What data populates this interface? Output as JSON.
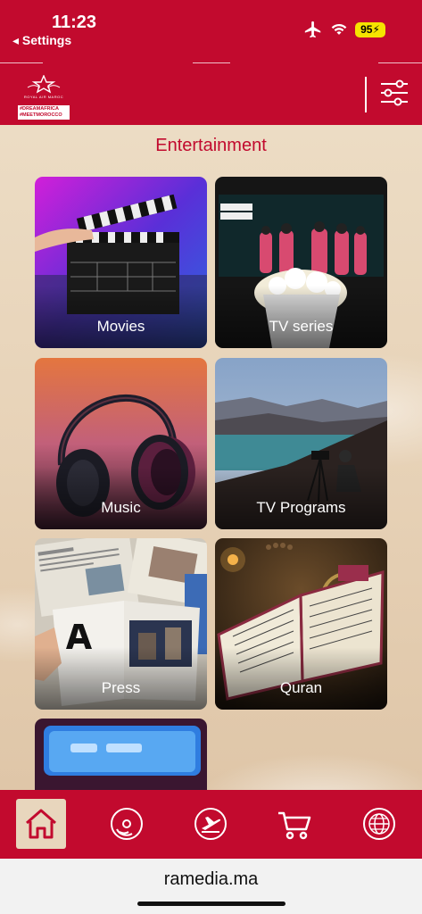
{
  "status_bar": {
    "time": "11:23",
    "back_label": "◂ Settings",
    "battery": "95",
    "icons": [
      "airplane-icon",
      "wifi-icon",
      "battery-icon"
    ]
  },
  "header": {
    "logo_sub": "ROYAL AIR MAROC",
    "logo_tag_1": "#DREAMAFRICA",
    "logo_tag_2": "#MEETMOROCCO",
    "filter_icon": "sliders-icon"
  },
  "page": {
    "title": "Entertainment",
    "tiles": [
      {
        "label": "Movies"
      },
      {
        "label": "TV series"
      },
      {
        "label": "Music"
      },
      {
        "label": "TV Programs"
      },
      {
        "label": "Press"
      },
      {
        "label": "Quran"
      },
      {
        "label": ""
      }
    ]
  },
  "bottom_nav": {
    "items": [
      "home-icon",
      "disc-icon",
      "plane-departure-icon",
      "cart-icon",
      "globe-icon"
    ]
  },
  "browser": {
    "url": "ramedia.ma"
  },
  "colors": {
    "brand_red": "#c20a2e",
    "title_red": "#c20a2e",
    "background": "#ecdcc4",
    "active_nav": "#e8d6bd"
  }
}
